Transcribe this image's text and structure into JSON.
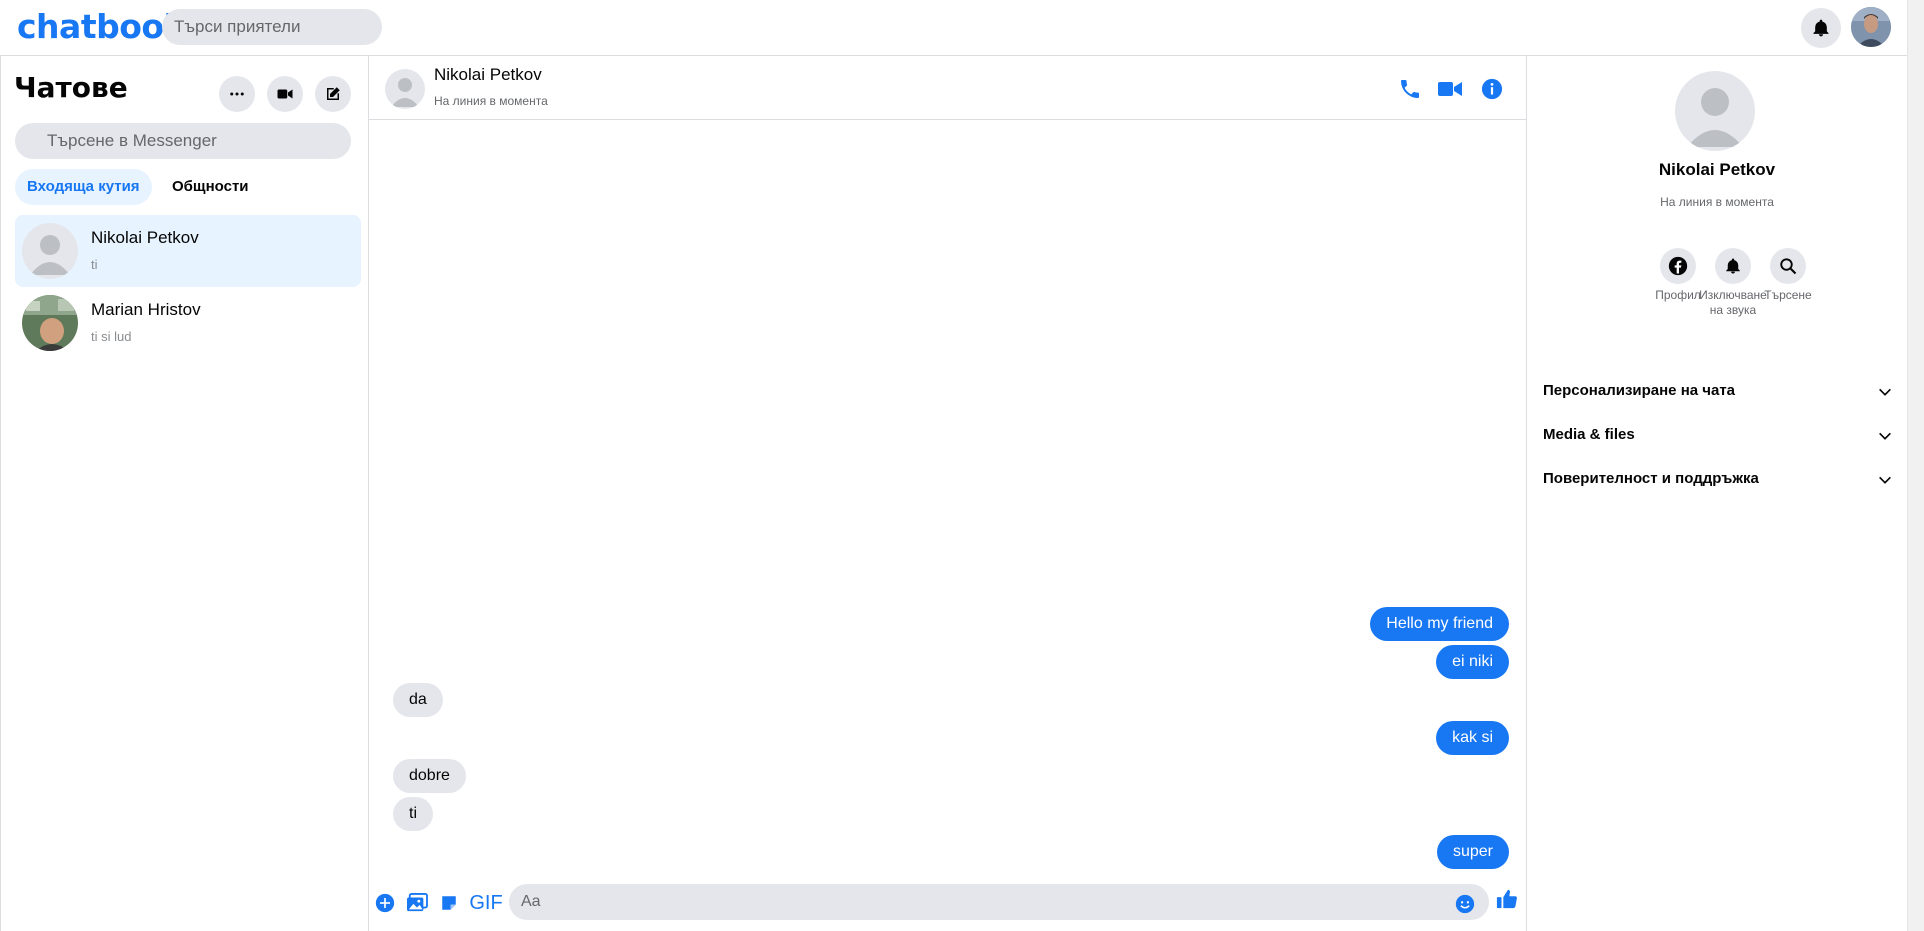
{
  "app": {
    "logo": "chatbook"
  },
  "topbar": {
    "search_placeholder": "Търси приятели",
    "icons": [
      "bell-icon",
      "user-avatar"
    ]
  },
  "sidebar": {
    "title": "Чатове",
    "buttons": [
      "more-icon",
      "video-icon",
      "compose-icon"
    ],
    "search_placeholder": "Търсене в Messenger",
    "tabs": [
      {
        "label": "Входяща кутия",
        "active": true
      },
      {
        "label": "Общности",
        "active": false
      }
    ],
    "chats": [
      {
        "name": "Nikolai Petkov",
        "preview": "ti",
        "active": true
      },
      {
        "name": "Marian Hristov",
        "preview": "ti si lud",
        "active": false
      }
    ]
  },
  "conversation": {
    "name": "Nikolai Petkov",
    "status": "На линия в момента",
    "header_icons": [
      "phone-icon",
      "video-icon",
      "info-icon"
    ],
    "messages": [
      {
        "text": "Hello my friend",
        "direction": "out"
      },
      {
        "text": "ei niki",
        "direction": "out"
      },
      {
        "text": "da",
        "direction": "in"
      },
      {
        "text": "kak si",
        "direction": "out"
      },
      {
        "text": "dobre",
        "direction": "in"
      },
      {
        "text": "ti",
        "direction": "in"
      },
      {
        "text": "super",
        "direction": "out"
      }
    ],
    "composer": {
      "gif_label": "GIF",
      "placeholder": "Aa",
      "icons": [
        "plus-circle-icon",
        "image-icon",
        "sticker-icon",
        "emoji-icon",
        "like-icon"
      ]
    }
  },
  "details": {
    "name": "Nikolai Petkov",
    "status": "На линия в момента",
    "actions": [
      {
        "label": "Профил",
        "icon": "facebook-icon"
      },
      {
        "label": "Изключване на звука",
        "icon": "bell-icon"
      },
      {
        "label": "Търсене",
        "icon": "search-icon"
      }
    ],
    "sections": [
      {
        "label": "Персонализиране на чата"
      },
      {
        "label": "Media & files"
      },
      {
        "label": "Поверителност и поддръжка"
      }
    ]
  },
  "colors": {
    "accent": "#1877f2",
    "bubble_in": "#e4e6eb",
    "active_bg": "#e7f3ff",
    "muted_text": "#65676b"
  }
}
